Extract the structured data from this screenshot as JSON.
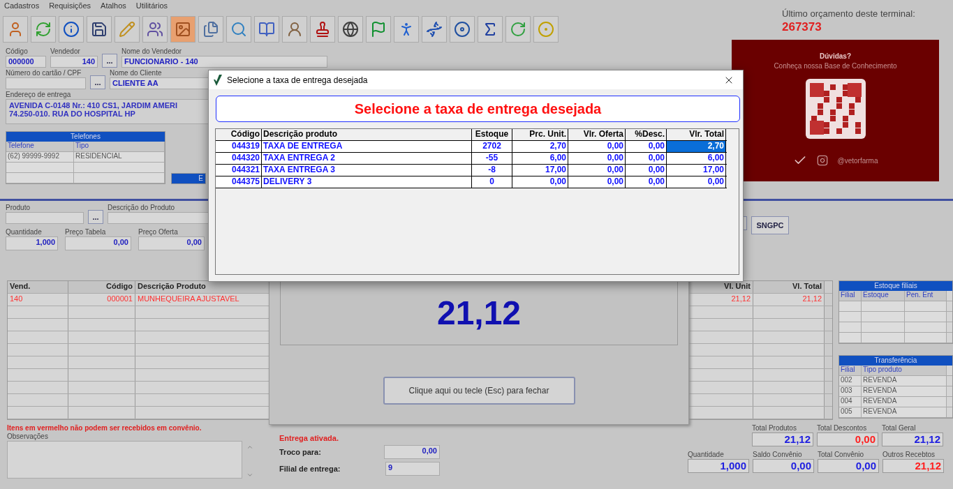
{
  "menu": [
    "Cadastros",
    "Requisições",
    "Atalhos",
    "Utilitários"
  ],
  "last_budget": {
    "label": "Último orçamento deste terminal:",
    "value": "267373"
  },
  "seller_form": {
    "code_label": "Código",
    "code": "000000",
    "seller_label": "Vendedor",
    "seller": "140",
    "seller_name_label": "Nome do Vendedor",
    "seller_name": "FUNCIONARIO - 140",
    "card_label": "Número do cartão / CPF",
    "client_label": "Nome do Cliente",
    "client": "CLIENTE AA",
    "address_label": "Endereço de entrega",
    "address_lines": [
      "AVENIDA C-0148 Nr.: 410 CS1, JARDIM AMERI",
      "74.250-010. RUA DO HOSPITAL HP"
    ],
    "more_button": "..."
  },
  "phones": {
    "title": "Telefones",
    "columns": [
      "Telefone",
      "Tipo"
    ],
    "rows": [
      [
        "(62) 99999-9992",
        "RESIDENCIAL"
      ],
      [
        "",
        ""
      ],
      [
        "",
        ""
      ]
    ]
  },
  "second_panel": {
    "title": "E"
  },
  "help_card": {
    "title": "Dúvidas?",
    "subtitle": "Conheça nossa Base de Conhecimento",
    "handle": "@vetorfarma"
  },
  "product_form": {
    "product_label": "Produto",
    "description_label": "Descrição do Produto",
    "quantity_label": "Quantidade",
    "quantity": "1,000",
    "table_price_label": "Preço Tabela",
    "table_price": "0,00",
    "offer_price_label": "Preço Oferta",
    "offer_price": "0,00",
    "more_button": "...",
    "sngpc_button": "SNGPC"
  },
  "items_table": {
    "columns": [
      "Vend.",
      "Código",
      "Descrição Produto",
      "Vl. Unit",
      "Vl. Total"
    ],
    "rows": [
      {
        "cells": [
          "140",
          "000001",
          "MUNHEQUEIRA  AJUSTAVEL",
          "21,12",
          "21,12"
        ],
        "color": "#ff3030"
      }
    ]
  },
  "total_popup": {
    "value": "21,12",
    "button": "Clique aqui ou tecle (Esc) para fechar"
  },
  "stock_panel": {
    "title": "Estoque filiais",
    "columns": [
      "Filial",
      "Estoque",
      "Pen. Ent"
    ],
    "rows": [
      [
        "",
        "",
        ""
      ],
      [
        "",
        "",
        ""
      ],
      [
        "",
        "",
        ""
      ],
      [
        "",
        "",
        ""
      ]
    ]
  },
  "transfer_panel": {
    "title": "Transferência",
    "columns": [
      "Filial",
      "Tipo produto"
    ],
    "rows": [
      [
        "002",
        "REVENDA"
      ],
      [
        "003",
        "REVENDA"
      ],
      [
        "004",
        "REVENDA"
      ],
      [
        "005",
        "REVENDA"
      ]
    ]
  },
  "notice": "Itens em vermelho não podem ser recebidos em convênio.",
  "notes_label": "Observações",
  "delivery": {
    "status": "Entrega ativada.",
    "change_label": "Troco para:",
    "change": "0,00",
    "branch_label": "Filial de entrega:",
    "branch": "9"
  },
  "totals": [
    {
      "label": "Total Produtos",
      "value": "21,12",
      "color": "#2020e0"
    },
    {
      "label": "Total Descontos",
      "value": "0,00",
      "color": "#ff2020"
    },
    {
      "label": "Total Geral",
      "value": "21,12",
      "color": "#2020e0"
    }
  ],
  "totals_2": [
    {
      "label": "Quantidade",
      "value": "1,000",
      "color": "#2020e0"
    },
    {
      "label": "Saldo Convênio",
      "value": "0,00",
      "color": "#2020e0"
    },
    {
      "label": "Total Convênio",
      "value": "0,00",
      "color": "#2020e0"
    },
    {
      "label": "Outros Recebtos",
      "value": "21,12",
      "color": "#ff2020"
    }
  ],
  "dialog": {
    "title": "Selecione a taxa de entrega desejada",
    "heading": "Selecione a taxa de entrega desejada",
    "columns": [
      "Código",
      "Descrição produto",
      "Estoque",
      "Prc. Unit.",
      "Vlr. Oferta",
      "%Desc.",
      "Vlr. Total"
    ],
    "rows": [
      {
        "cells": [
          "044319",
          "TAXA DE ENTREGA",
          "2702",
          "2,70",
          "0,00",
          "0,00",
          "2,70"
        ],
        "selected": true
      },
      {
        "cells": [
          "044320",
          "TAXA ENTREGA 2",
          "-55",
          "6,00",
          "0,00",
          "0,00",
          "6,00"
        ],
        "selected": false
      },
      {
        "cells": [
          "044321",
          "TAXA ENTREGA 3",
          "-8",
          "17,00",
          "0,00",
          "0,00",
          "17,00"
        ],
        "selected": false
      },
      {
        "cells": [
          "044375",
          "DELIVERY 3",
          "0",
          "0,00",
          "0,00",
          "0,00",
          "0,00"
        ],
        "selected": false
      }
    ]
  }
}
